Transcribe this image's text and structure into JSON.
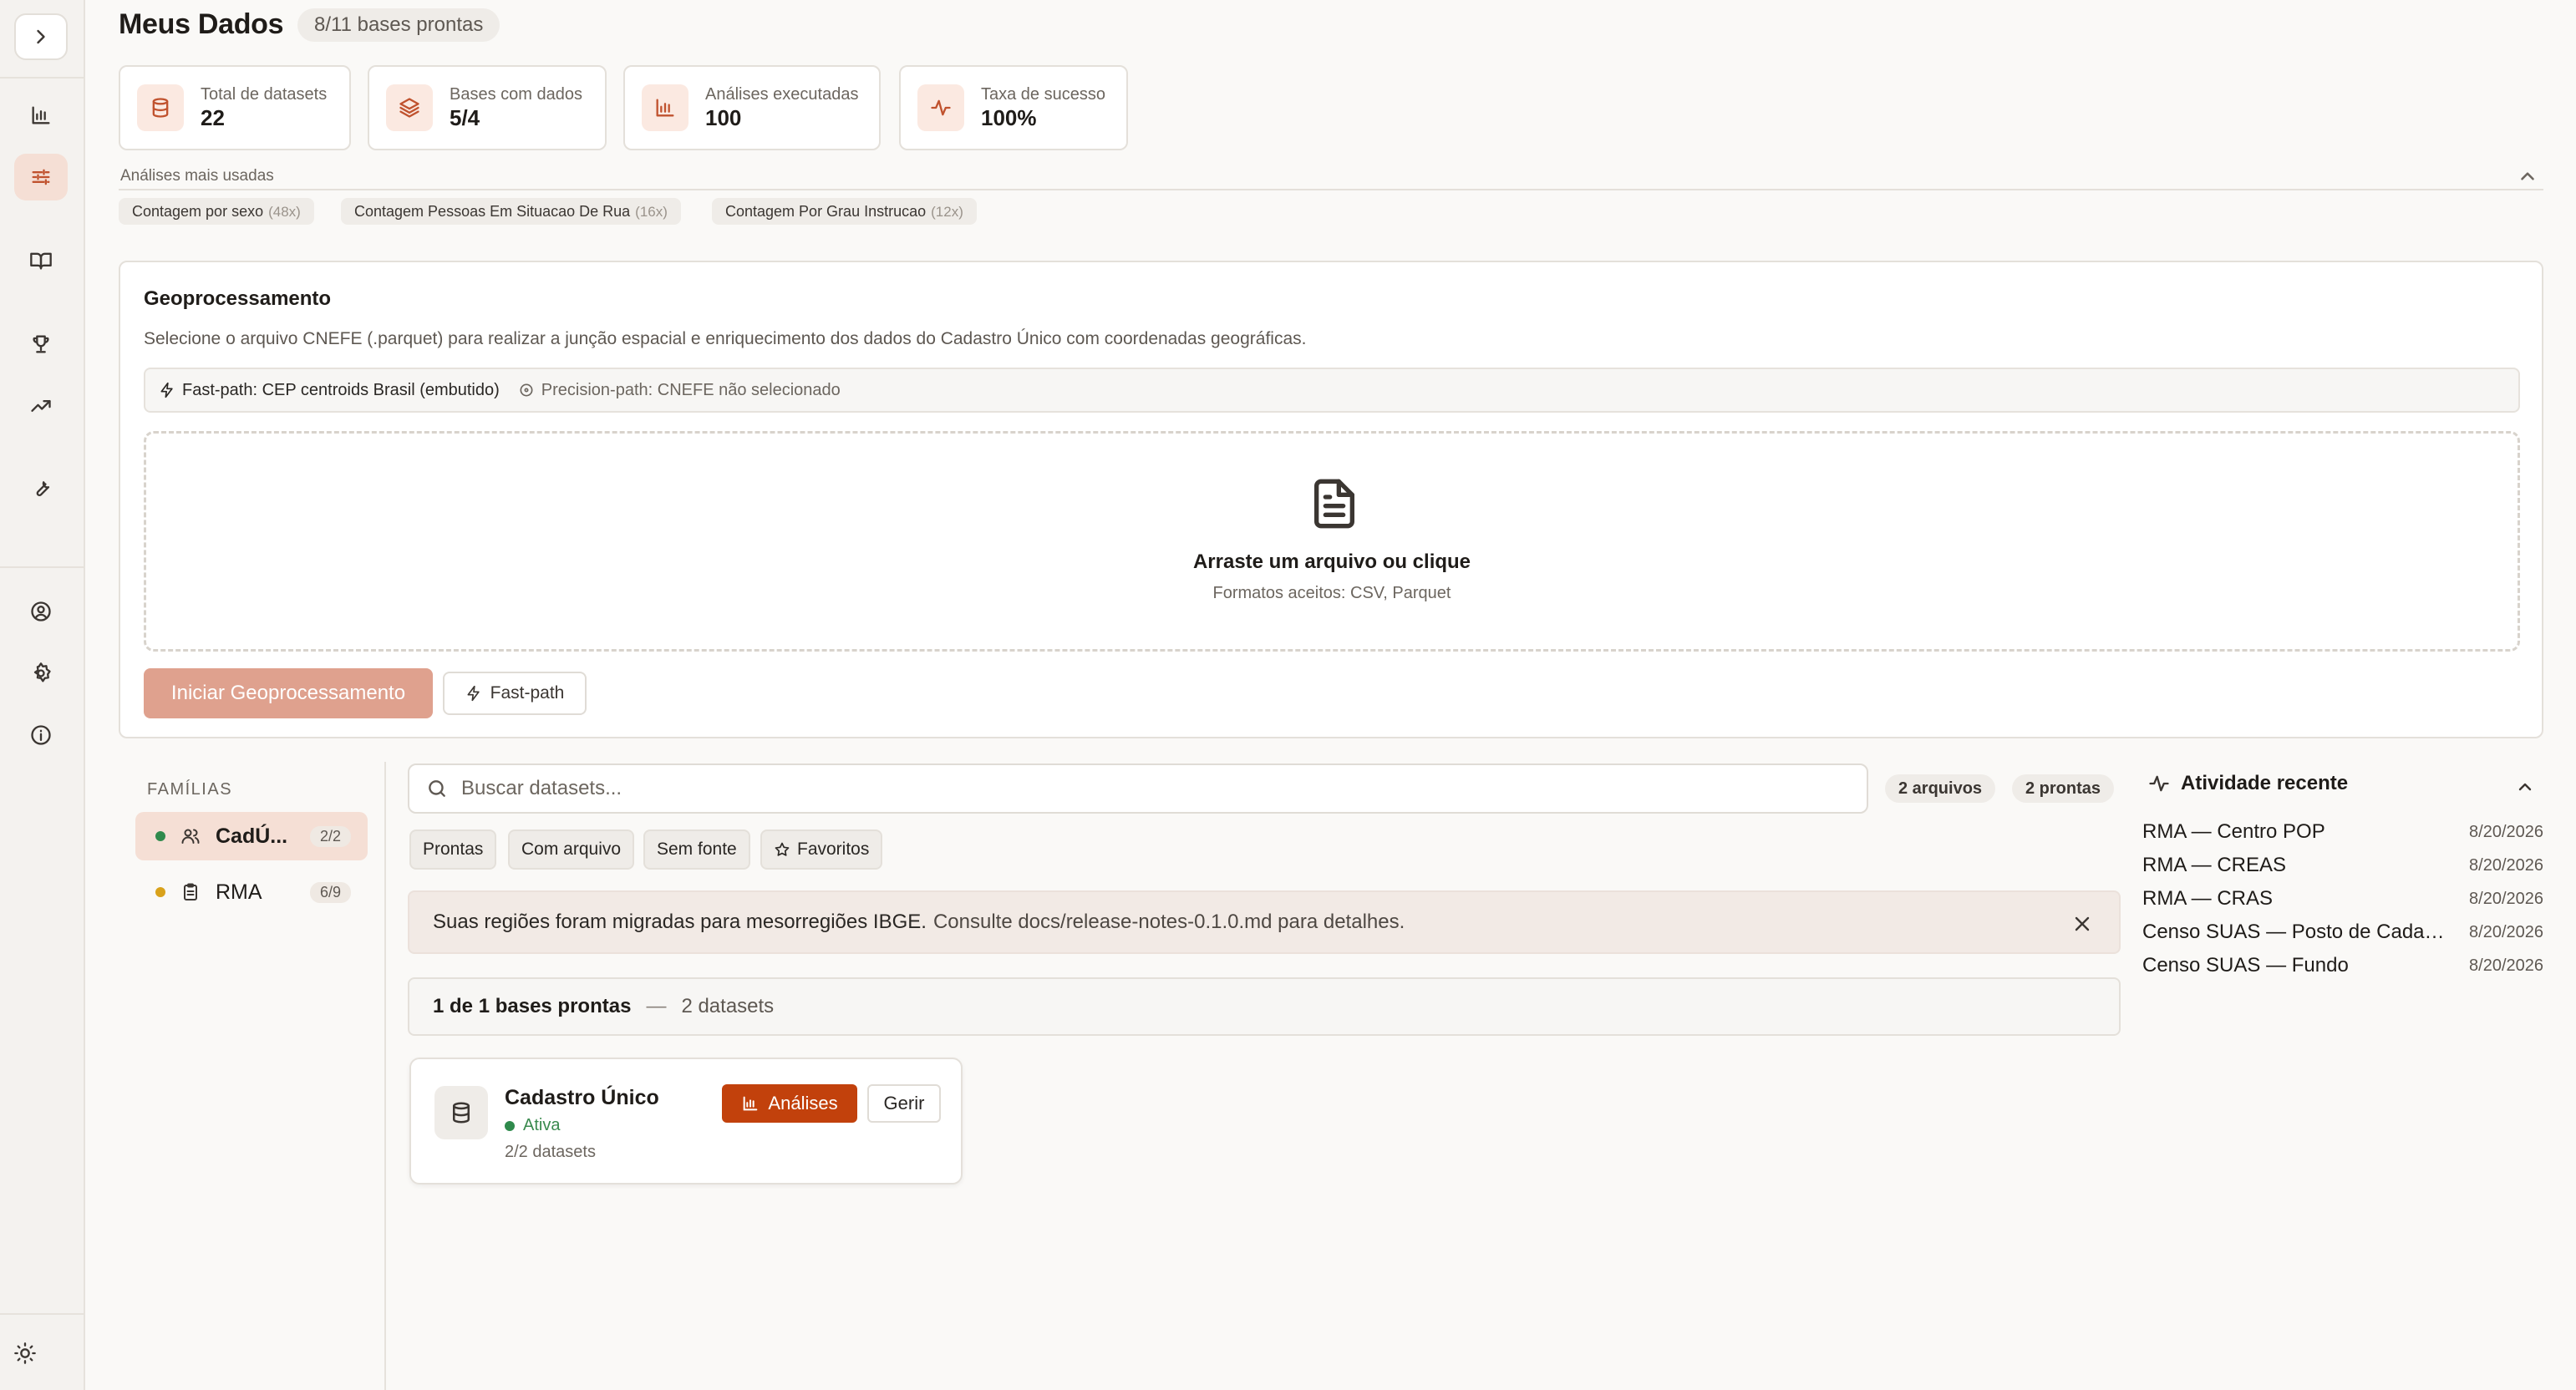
{
  "header": {
    "title": "Meus Dados",
    "badge": "8/11 bases prontas"
  },
  "stats": [
    {
      "label": "Total de datasets",
      "value": "22",
      "icon": "database-icon"
    },
    {
      "label": "Bases com dados",
      "value": "5/4",
      "icon": "layers-icon"
    },
    {
      "label": "Análises executadas",
      "value": "100",
      "icon": "bar-chart-icon"
    },
    {
      "label": "Taxa de sucesso",
      "value": "100%",
      "icon": "activity-icon"
    }
  ],
  "most_used": {
    "title": "Análises mais usadas",
    "items": [
      {
        "label": "Contagem por sexo",
        "count": "(48x)"
      },
      {
        "label": "Contagem Pessoas Em Situacao De Rua",
        "count": "(16x)"
      },
      {
        "label": "Contagem Por Grau Instrucao",
        "count": "(12x)"
      }
    ]
  },
  "geo": {
    "title": "Geoprocessamento",
    "description": "Selecione o arquivo CNEFE (.parquet) para realizar a junção espacial e enriquecimento dos dados do Cadastro Único com coordenadas geográficas.",
    "fast_path": "Fast-path: CEP centroids Brasil (embutido)",
    "precision_path": "Precision-path: CNEFE não selecionado",
    "dropzone_title": "Arraste um arquivo ou clique",
    "dropzone_sub": "Formatos aceitos: CSV, Parquet",
    "start_button": "Iniciar Geoprocessamento",
    "fast_button": "Fast-path"
  },
  "families": {
    "title": "FAMÍLIAS",
    "items": [
      {
        "name": "CadÚ...",
        "count": "2/2",
        "dot_color": "#2f8a4c",
        "active": true
      },
      {
        "name": "RMA",
        "count": "6/9",
        "dot_color": "#d9a21b",
        "active": false
      }
    ]
  },
  "search": {
    "placeholder": "Buscar datasets...",
    "files_pill": "2 arquivos",
    "ready_pill": "2 prontas"
  },
  "filters": [
    "Prontas",
    "Com arquivo",
    "Sem fonte",
    "Favoritos"
  ],
  "notice": {
    "main": "Suas regiões foram migradas para mesorregiões IBGE.",
    "detail": "Consulte docs/release-notes-0.1.0.md para detalhes."
  },
  "summary": {
    "ready": "1 de 1 bases prontas",
    "separator": "—",
    "datasets": "2 datasets"
  },
  "dataset_card": {
    "name": "Cadastro Único",
    "status": "Ativa",
    "sub": "2/2 datasets",
    "analises_button": "Análises",
    "gerir_button": "Gerir"
  },
  "activity": {
    "title": "Atividade recente",
    "items": [
      {
        "name": "RMA — Centro POP",
        "date": "8/20/2026"
      },
      {
        "name": "RMA — CREAS",
        "date": "8/20/2026"
      },
      {
        "name": "RMA — CRAS",
        "date": "8/20/2026"
      },
      {
        "name": "Censo SUAS — Posto de Cadastramento",
        "date": "8/20/2026"
      },
      {
        "name": "Censo SUAS — Fundo",
        "date": "8/20/2026"
      }
    ]
  },
  "colors": {
    "accent": "#c2410c",
    "accent_soft": "#f5dfd5",
    "start_button": "#dfa18e",
    "status_green": "#2f8a4c"
  }
}
